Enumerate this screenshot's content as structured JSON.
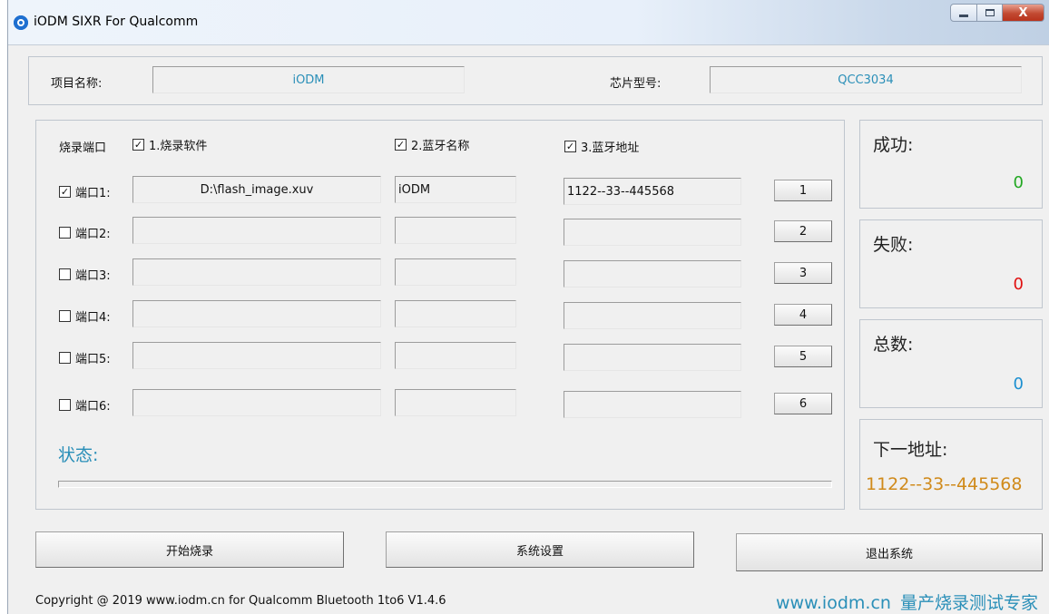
{
  "window": {
    "title": "iODM SIXR For Qualcomm",
    "close_glyph": "X"
  },
  "project": {
    "name_label": "项目名称:",
    "name_value": "iODM",
    "chip_label": "芯片型号:",
    "chip_value": "QCC3034"
  },
  "header": {
    "port_label": "烧录端口",
    "options": [
      {
        "label": "1.烧录软件",
        "checked": true
      },
      {
        "label": "2.蓝牙名称",
        "checked": true
      },
      {
        "label": "3.蓝牙地址",
        "checked": true
      }
    ]
  },
  "ports": [
    {
      "label": "端口1:",
      "checked": true,
      "file": "D:\\flash_image.xuv",
      "bt_name": "iODM",
      "bt_addr": "1122--33--445568",
      "button": "1"
    },
    {
      "label": "端口2:",
      "checked": false,
      "file": "",
      "bt_name": "",
      "bt_addr": "",
      "button": "2"
    },
    {
      "label": "端口3:",
      "checked": false,
      "file": "",
      "bt_name": "",
      "bt_addr": "",
      "button": "3"
    },
    {
      "label": "端口4:",
      "checked": false,
      "file": "",
      "bt_name": "",
      "bt_addr": "",
      "button": "4"
    },
    {
      "label": "端口5:",
      "checked": false,
      "file": "",
      "bt_name": "",
      "bt_addr": "",
      "button": "5"
    },
    {
      "label": "端口6:",
      "checked": false,
      "file": "",
      "bt_name": "",
      "bt_addr": "",
      "button": "6"
    }
  ],
  "status": {
    "label": "状态:",
    "progress_percent": 0
  },
  "stats": {
    "success_label": "成功:",
    "success_value": "0",
    "fail_label": "失败:",
    "fail_value": "0",
    "total_label": "总数:",
    "total_value": "0",
    "next_label": "下一地址:",
    "next_value": "1122--33--445568"
  },
  "actions": {
    "start": "开始烧录",
    "settings": "系统设置",
    "exit": "退出系统"
  },
  "footer": {
    "copyright": "Copyright @ 2019 www.iodm.cn for Qualcomm Bluetooth 1to6 V1.4.6",
    "brand_url": "www.iodm.cn",
    "brand_slogan": "量产烧录测试专家"
  },
  "colors": {
    "accent_teal": "#2a8fb8",
    "success_green": "#22a822",
    "fail_red": "#e01010",
    "total_blue": "#1b8fd0",
    "next_orange": "#d08a1a"
  }
}
